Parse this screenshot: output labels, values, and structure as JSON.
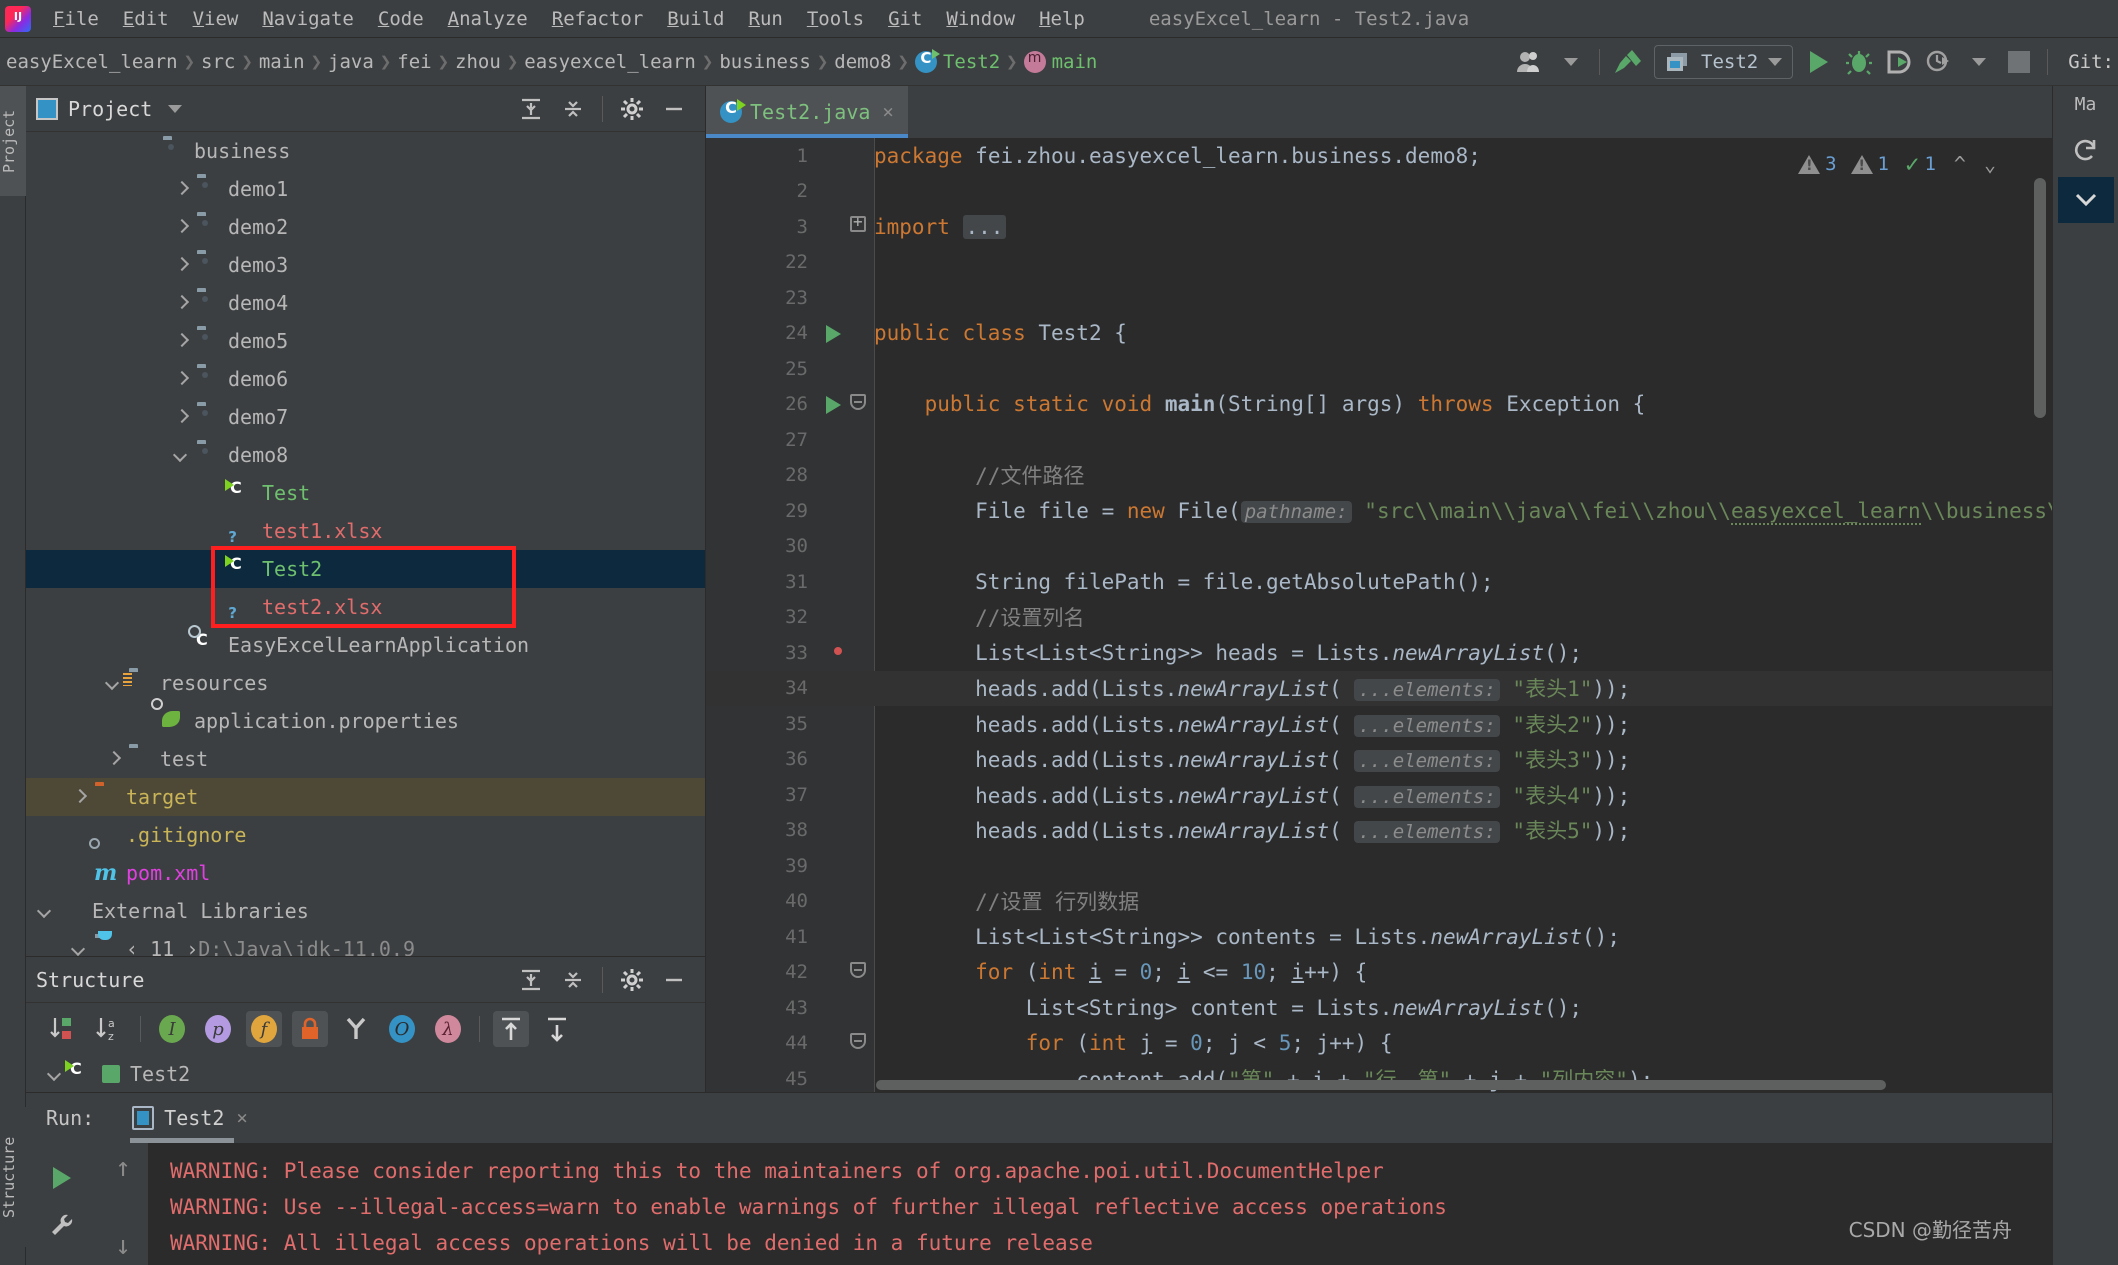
{
  "window": {
    "title": "easyExcel_learn - Test2.java"
  },
  "menubar": {
    "items": [
      "File",
      "Edit",
      "View",
      "Navigate",
      "Code",
      "Analyze",
      "Refactor",
      "Build",
      "Run",
      "Tools",
      "Git",
      "Window",
      "Help"
    ]
  },
  "navbar": {
    "breadcrumbs": [
      "easyExcel_learn",
      "src",
      "main",
      "java",
      "fei",
      "zhou",
      "easyexcel_learn",
      "business",
      "demo8"
    ],
    "class_crumb": "Test2",
    "method_crumb": "main",
    "run_config": "Test2",
    "git_label": "Git:"
  },
  "left_stripe": {
    "project_tab": "Project",
    "structure_tab": "Structure"
  },
  "right_stripe": {
    "maven_tab": "Ma"
  },
  "project_panel": {
    "title": "Project",
    "tree": [
      {
        "indent": 3,
        "chev": "none",
        "icon": "folder",
        "label": "business",
        "color": "grey",
        "state": ""
      },
      {
        "indent": 4,
        "chev": "closed",
        "icon": "folder",
        "label": "demo1",
        "color": "grey",
        "state": ""
      },
      {
        "indent": 4,
        "chev": "closed",
        "icon": "folder",
        "label": "demo2",
        "color": "grey",
        "state": ""
      },
      {
        "indent": 4,
        "chev": "closed",
        "icon": "folder",
        "label": "demo3",
        "color": "grey",
        "state": ""
      },
      {
        "indent": 4,
        "chev": "closed",
        "icon": "folder",
        "label": "demo4",
        "color": "grey",
        "state": ""
      },
      {
        "indent": 4,
        "chev": "closed",
        "icon": "folder",
        "label": "demo5",
        "color": "grey",
        "state": ""
      },
      {
        "indent": 4,
        "chev": "closed",
        "icon": "folder",
        "label": "demo6",
        "color": "grey",
        "state": ""
      },
      {
        "indent": 4,
        "chev": "closed",
        "icon": "folder",
        "label": "demo7",
        "color": "grey",
        "state": ""
      },
      {
        "indent": 4,
        "chev": "open",
        "icon": "folder",
        "label": "demo8",
        "color": "grey",
        "state": ""
      },
      {
        "indent": 5,
        "chev": "none",
        "icon": "class",
        "label": "Test",
        "color": "green",
        "state": ""
      },
      {
        "indent": 5,
        "chev": "none",
        "icon": "xlsx",
        "label": "test1.xlsx",
        "color": "red",
        "state": ""
      },
      {
        "indent": 5,
        "chev": "none",
        "icon": "class",
        "label": "Test2",
        "color": "green",
        "state": "selected"
      },
      {
        "indent": 5,
        "chev": "none",
        "icon": "xlsx",
        "label": "test2.xlsx",
        "color": "red",
        "state": ""
      },
      {
        "indent": 4,
        "chev": "none",
        "icon": "springclass",
        "label": "EasyExcelLearnApplication",
        "color": "grey",
        "state": ""
      },
      {
        "indent": 2,
        "chev": "open",
        "icon": "resources",
        "label": "resources",
        "color": "grey",
        "state": ""
      },
      {
        "indent": 3,
        "chev": "none",
        "icon": "spring",
        "label": "application.properties",
        "color": "grey",
        "state": ""
      },
      {
        "indent": 2,
        "chev": "closed",
        "icon": "plainfolder",
        "label": "test",
        "color": "grey",
        "state": ""
      },
      {
        "indent": 1,
        "chev": "closed",
        "icon": "orangefolder",
        "label": "target",
        "color": "yellow",
        "state": "target"
      },
      {
        "indent": 1,
        "chev": "none",
        "icon": "gitignore",
        "label": ".gitignore",
        "color": "yellow",
        "state": ""
      },
      {
        "indent": 1,
        "chev": "none",
        "icon": "maven",
        "label": "pom.xml",
        "color": "pink",
        "state": ""
      },
      {
        "indent": 0,
        "chev": "open",
        "icon": "libs",
        "label": "External Libraries",
        "color": "grey",
        "state": ""
      },
      {
        "indent": 1,
        "chev": "open",
        "icon": "jdk",
        "label": "‹ 11 ›",
        "label2": "D:\\Java\\jdk-11.0.9",
        "color": "grey",
        "state": ""
      }
    ]
  },
  "structure_panel": {
    "title": "Structure",
    "toolbar_icons": [
      "sort-by-visibility-icon",
      "sort-alphabetically-icon",
      "show-inherited-icon",
      "show-properties-icon",
      "show-fields-icon",
      "show-non-public-icon",
      "group-methods-icon",
      "show-anonymous-icon",
      "show-lambdas-icon",
      "expand-all-icon",
      "collapse-all-icon"
    ],
    "root_item": "Test2"
  },
  "editor": {
    "tab": {
      "label": "Test2.java",
      "close": "×"
    },
    "inspections": {
      "warnings": "3",
      "weak_warnings": "1",
      "ok": "1"
    },
    "lines": [
      {
        "n": "1",
        "gutter": "",
        "fold": "",
        "hl": false,
        "html": "<span class=\"kw\">package</span> <span class=\"ident\">fei.zhou.easyexcel_learn.business.demo8</span><span class=\"ident\">;</span>"
      },
      {
        "n": "2",
        "gutter": "",
        "fold": "",
        "hl": false,
        "html": ""
      },
      {
        "n": "3",
        "gutter": "",
        "fold": "expand",
        "hl": false,
        "html": "<span class=\"kw\">import</span> <span class=\"folded\">...</span>"
      },
      {
        "n": "22",
        "gutter": "",
        "fold": "",
        "hl": false,
        "html": ""
      },
      {
        "n": "23",
        "gutter": "",
        "fold": "",
        "hl": false,
        "html": ""
      },
      {
        "n": "24",
        "gutter": "run",
        "fold": "",
        "hl": false,
        "html": "<span class=\"kw\">public class</span> <span class=\"ident\">Test2</span> <span class=\"ident\">{</span>"
      },
      {
        "n": "25",
        "gutter": "",
        "fold": "",
        "hl": false,
        "html": ""
      },
      {
        "n": "26",
        "gutter": "run",
        "fold": "collapse",
        "hl": false,
        "html": "    <span class=\"kw\">public static void</span> <span class=\"ident\" style=\"font-weight:bold\">main</span><span class=\"ident\">(String[] args) </span><span class=\"kw\">throws</span> <span class=\"ident\">Exception {</span>"
      },
      {
        "n": "27",
        "gutter": "",
        "fold": "",
        "hl": false,
        "html": ""
      },
      {
        "n": "28",
        "gutter": "",
        "fold": "",
        "hl": false,
        "html": "        <span class=\"cmt\">//文件路径</span>"
      },
      {
        "n": "29",
        "gutter": "",
        "fold": "",
        "hl": false,
        "html": "        <span class=\"ident\">File file = </span><span class=\"kw\">new</span> <span class=\"ident\">File(</span><span class=\"hint\">pathname:</span> <span class=\"str\">\"src\\\\main\\\\java\\\\fei\\\\zhou\\\\</span><span class=\"str wavy\">easyexcel_learn</span><span class=\"str\">\\\\business\\\\demo</span>"
      },
      {
        "n": "30",
        "gutter": "",
        "fold": "",
        "hl": false,
        "html": ""
      },
      {
        "n": "31",
        "gutter": "",
        "fold": "",
        "hl": false,
        "html": "        <span class=\"ident\">String filePath = file.getAbsolutePath();</span>"
      },
      {
        "n": "32",
        "gutter": "",
        "fold": "",
        "hl": false,
        "html": "        <span class=\"cmt\">//设置列名</span>"
      },
      {
        "n": "33",
        "gutter": "dot",
        "fold": "",
        "hl": false,
        "html": "        <span class=\"ident\">List&lt;List&lt;String&gt;&gt; heads = Lists.</span><span class=\"mth-it\">newArrayList</span><span class=\"ident\">();</span>"
      },
      {
        "n": "34",
        "gutter": "",
        "fold": "",
        "hl": true,
        "html": "        <span class=\"ident\">heads.add(Lists.</span><span class=\"mth-it\">newArrayList</span><span class=\"ident\">(</span> <span class=\"hint\">...elements:</span> <span class=\"str\">\"表头1\"</span><span class=\"ident\">));</span>"
      },
      {
        "n": "35",
        "gutter": "",
        "fold": "",
        "hl": false,
        "html": "        <span class=\"ident\">heads.add(Lists.</span><span class=\"mth-it\">newArrayList</span><span class=\"ident\">(</span> <span class=\"hint\">...elements:</span> <span class=\"str\">\"表头2\"</span><span class=\"ident\">));</span>"
      },
      {
        "n": "36",
        "gutter": "",
        "fold": "",
        "hl": false,
        "html": "        <span class=\"ident\">heads.add(Lists.</span><span class=\"mth-it\">newArrayList</span><span class=\"ident\">(</span> <span class=\"hint\">...elements:</span> <span class=\"str\">\"表头3\"</span><span class=\"ident\">));</span>"
      },
      {
        "n": "37",
        "gutter": "",
        "fold": "",
        "hl": false,
        "html": "        <span class=\"ident\">heads.add(Lists.</span><span class=\"mth-it\">newArrayList</span><span class=\"ident\">(</span> <span class=\"hint\">...elements:</span> <span class=\"str\">\"表头4\"</span><span class=\"ident\">));</span>"
      },
      {
        "n": "38",
        "gutter": "",
        "fold": "",
        "hl": false,
        "html": "        <span class=\"ident\">heads.add(Lists.</span><span class=\"mth-it\">newArrayList</span><span class=\"ident\">(</span> <span class=\"hint\">...elements:</span> <span class=\"str\">\"表头5\"</span><span class=\"ident\">));</span>"
      },
      {
        "n": "39",
        "gutter": "",
        "fold": "",
        "hl": false,
        "html": ""
      },
      {
        "n": "40",
        "gutter": "",
        "fold": "",
        "hl": false,
        "html": "        <span class=\"cmt\">//设置 行列数据</span>"
      },
      {
        "n": "41",
        "gutter": "",
        "fold": "",
        "hl": false,
        "html": "        <span class=\"ident\">List&lt;List&lt;String&gt;&gt; contents = Lists.</span><span class=\"mth-it\">newArrayList</span><span class=\"ident\">();</span>"
      },
      {
        "n": "42",
        "gutter": "",
        "fold": "collapse",
        "hl": false,
        "html": "        <span class=\"kw\">for</span> <span class=\"ident\">(</span><span class=\"kw\">int</span> <span class=\"ident\" style=\"text-decoration:underline\">i</span> <span class=\"ident\">= </span><span class=\"num\">0</span><span class=\"ident\">; </span><span class=\"ident\" style=\"text-decoration:underline\">i</span> <span class=\"ident\">&lt;= </span><span class=\"num\">10</span><span class=\"ident\">; </span><span class=\"ident\" style=\"text-decoration:underline\">i</span><span class=\"ident\">++) {</span>"
      },
      {
        "n": "43",
        "gutter": "",
        "fold": "",
        "hl": false,
        "html": "            <span class=\"ident\">List&lt;String&gt; content = Lists.</span><span class=\"mth-it\">newArrayList</span><span class=\"ident\">();</span>"
      },
      {
        "n": "44",
        "gutter": "",
        "fold": "collapse",
        "hl": false,
        "html": "            <span class=\"kw\">for</span> <span class=\"ident\">(</span><span class=\"kw\">int</span> <span class=\"ident\" style=\"text-decoration:underline\">j</span> <span class=\"ident\">= </span><span class=\"num\">0</span><span class=\"ident\">; j &lt; </span><span class=\"num\">5</span><span class=\"ident\">; j++) {</span>"
      },
      {
        "n": "45",
        "gutter": "",
        "fold": "",
        "hl": false,
        "html": "                <span class=\"ident\">content.add(</span><span class=\"str\">\"第\"</span><span class=\"ident\"> + i + </span><span class=\"str\">\"行，第\"</span><span class=\"ident\"> + j + </span><span class=\"str\">\"列内容\"</span><span class=\"ident\">);</span>"
      }
    ]
  },
  "console": {
    "run_label": "Run:",
    "tab_label": "Test2",
    "tab_close": "×",
    "output": [
      "WARNING: Please consider reporting this to the maintainers of org.apache.poi.util.DocumentHelper",
      "WARNING: Use --illegal-access=warn to enable warnings of further illegal reflective access operations",
      "WARNING: All illegal access operations will be denied in a future release"
    ],
    "watermark": "CSDN @勤径苦舟"
  },
  "colors": {
    "accent_blue": "#3592c4",
    "selection": "#0d293e",
    "target_row": "#4e4837",
    "run_green": "#59a869",
    "warning_red": "#e06c6c",
    "highlight_box": "#ff1f1f",
    "editor_bg": "#2b2b2b",
    "panel_bg": "#3c3f41"
  }
}
